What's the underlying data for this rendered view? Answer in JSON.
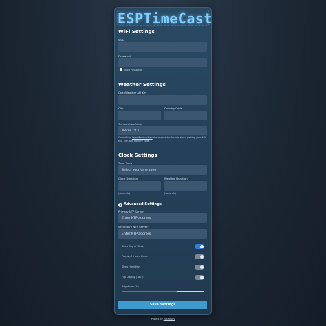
{
  "app": {
    "title": "ESPTimeCast"
  },
  "wifi": {
    "heading": "WiFi Settings",
    "ssid_label": "SSID",
    "ssid_value": "",
    "password_label": "Password",
    "password_value": "",
    "show_password_label": "Show Password"
  },
  "weather": {
    "heading": "Weather Settings",
    "api_key_label": "OpenWeather API Key",
    "api_key_value": "",
    "city_label": "City",
    "city_value": "",
    "country_label": "Country Code",
    "country_value": "",
    "units_label": "Temperature Units",
    "units_value": "Metric (°C)",
    "note_prefix": "Consult the ",
    "note_link": "OpenWeatherMap",
    "note_suffix": " documentation for info about getting your API key, city, and country code."
  },
  "clock": {
    "heading": "Clock Settings",
    "timezone_label": "Time Zone",
    "timezone_value": "Select your time zone",
    "clock_duration_label": "Clock Duration",
    "clock_duration_value": "",
    "clock_duration_hint": "(Seconds)",
    "weather_duration_label": "Weather Duration",
    "weather_duration_value": "",
    "weather_duration_hint": "(Seconds)"
  },
  "advanced": {
    "heading": "Advanced Settings",
    "icon": "gear-icon",
    "ntp_primary_label": "Primary NTP Server:",
    "ntp_primary_placeholder": "Enter NTP address",
    "ntp_secondary_label": "Secondary NTP Server:",
    "ntp_secondary_placeholder": "Enter NTP address",
    "toggles": [
      {
        "label": "Show Day of Week:",
        "on": true
      },
      {
        "label": "Display 12-hour Clock:",
        "on": false
      },
      {
        "label": "Show Humidity:",
        "on": false
      },
      {
        "label": "Flip Display (180°):",
        "on": false
      }
    ],
    "brightness_label": "Brightness: 10",
    "brightness_fraction": 0.67
  },
  "actions": {
    "save_label": "Save Settings"
  },
  "footer": {
    "prefix": "Project by ",
    "link": "M-Factory"
  },
  "colors": {
    "accent": "#2f7ee6",
    "button": "#3d9bd0",
    "logo": "#7fd0ff"
  }
}
